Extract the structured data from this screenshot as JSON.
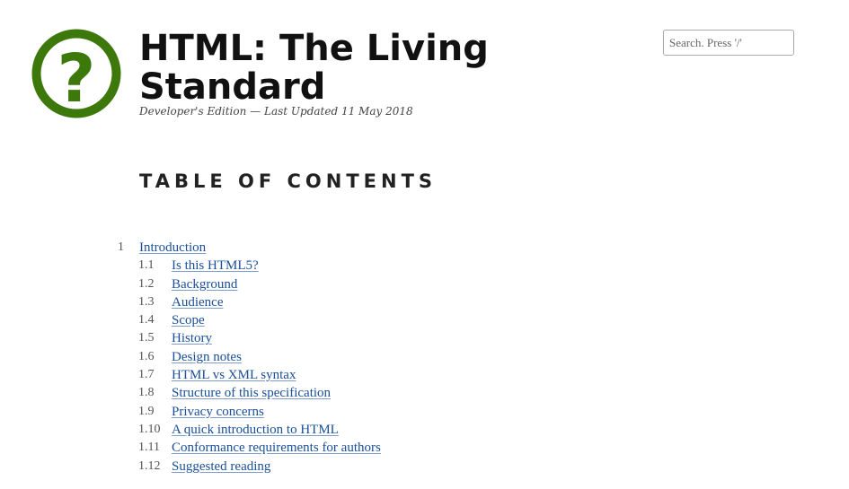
{
  "header": {
    "title": "HTML: The Living Standard",
    "subtitle": "Developer's Edition — Last Updated 11 May 2018",
    "logo_icon": "question-mark-circle-icon",
    "logo_glyph": "?"
  },
  "search": {
    "placeholder": "Search. Press '/'"
  },
  "toc": {
    "heading": "TABLE OF CONTENTS",
    "items": [
      {
        "num": "1",
        "label": "Introduction"
      },
      {
        "num": "1.1",
        "label": "Is this HTML5?"
      },
      {
        "num": "1.2",
        "label": "Background"
      },
      {
        "num": "1.3",
        "label": "Audience"
      },
      {
        "num": "1.4",
        "label": "Scope"
      },
      {
        "num": "1.5",
        "label": "History"
      },
      {
        "num": "1.6",
        "label": "Design notes"
      },
      {
        "num": "1.7",
        "label": "HTML vs XML syntax"
      },
      {
        "num": "1.8",
        "label": "Structure of this specification"
      },
      {
        "num": "1.9",
        "label": "Privacy concerns"
      },
      {
        "num": "1.10",
        "label": "A quick introduction to HTML"
      },
      {
        "num": "1.11",
        "label": "Conformance requirements for authors"
      },
      {
        "num": "1.12",
        "label": "Suggested reading"
      }
    ]
  },
  "colors": {
    "logo_green": "#3c790a",
    "link_blue": "#1a4f99"
  }
}
